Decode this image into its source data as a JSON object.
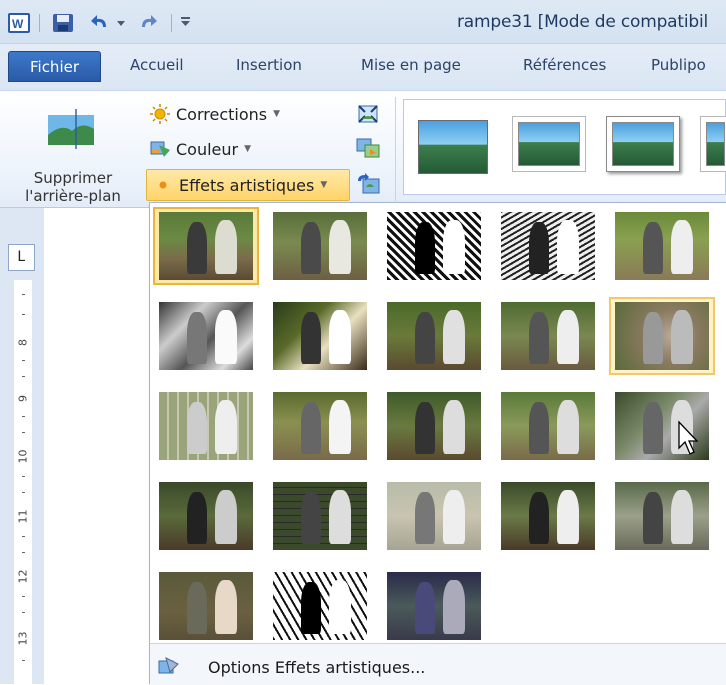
{
  "titlebar": {
    "title": "rampe31 [Mode de compatibil",
    "icons": [
      "word-app-icon",
      "save-icon",
      "undo-icon",
      "redo-icon",
      "customize-qat-icon"
    ]
  },
  "tabs": {
    "file": "Fichier",
    "items": [
      "Accueil",
      "Insertion",
      "Mise en page",
      "Références",
      "Publipo"
    ]
  },
  "ribbon": {
    "remove_background": {
      "line1": "Supprimer",
      "line2": "l'arrière-plan"
    },
    "adjust": [
      {
        "label": "Corrections",
        "icon": "sun-icon"
      },
      {
        "label": "Couleur",
        "icon": "color-icon"
      },
      {
        "label": "Effets artistiques",
        "icon": "artistic-effects-icon"
      }
    ]
  },
  "ruler": {
    "corner": "L",
    "numbers": [
      "8",
      "9",
      "10",
      "11",
      "12",
      "13"
    ]
  },
  "gallery": {
    "selected_index": 0,
    "hover_index": 9,
    "options_link": "Options Effets artistiques..."
  },
  "colors": {
    "accent": "#2a5aa8",
    "selection": "#e8b640",
    "ribbon_bg": "#e3ecf8"
  }
}
